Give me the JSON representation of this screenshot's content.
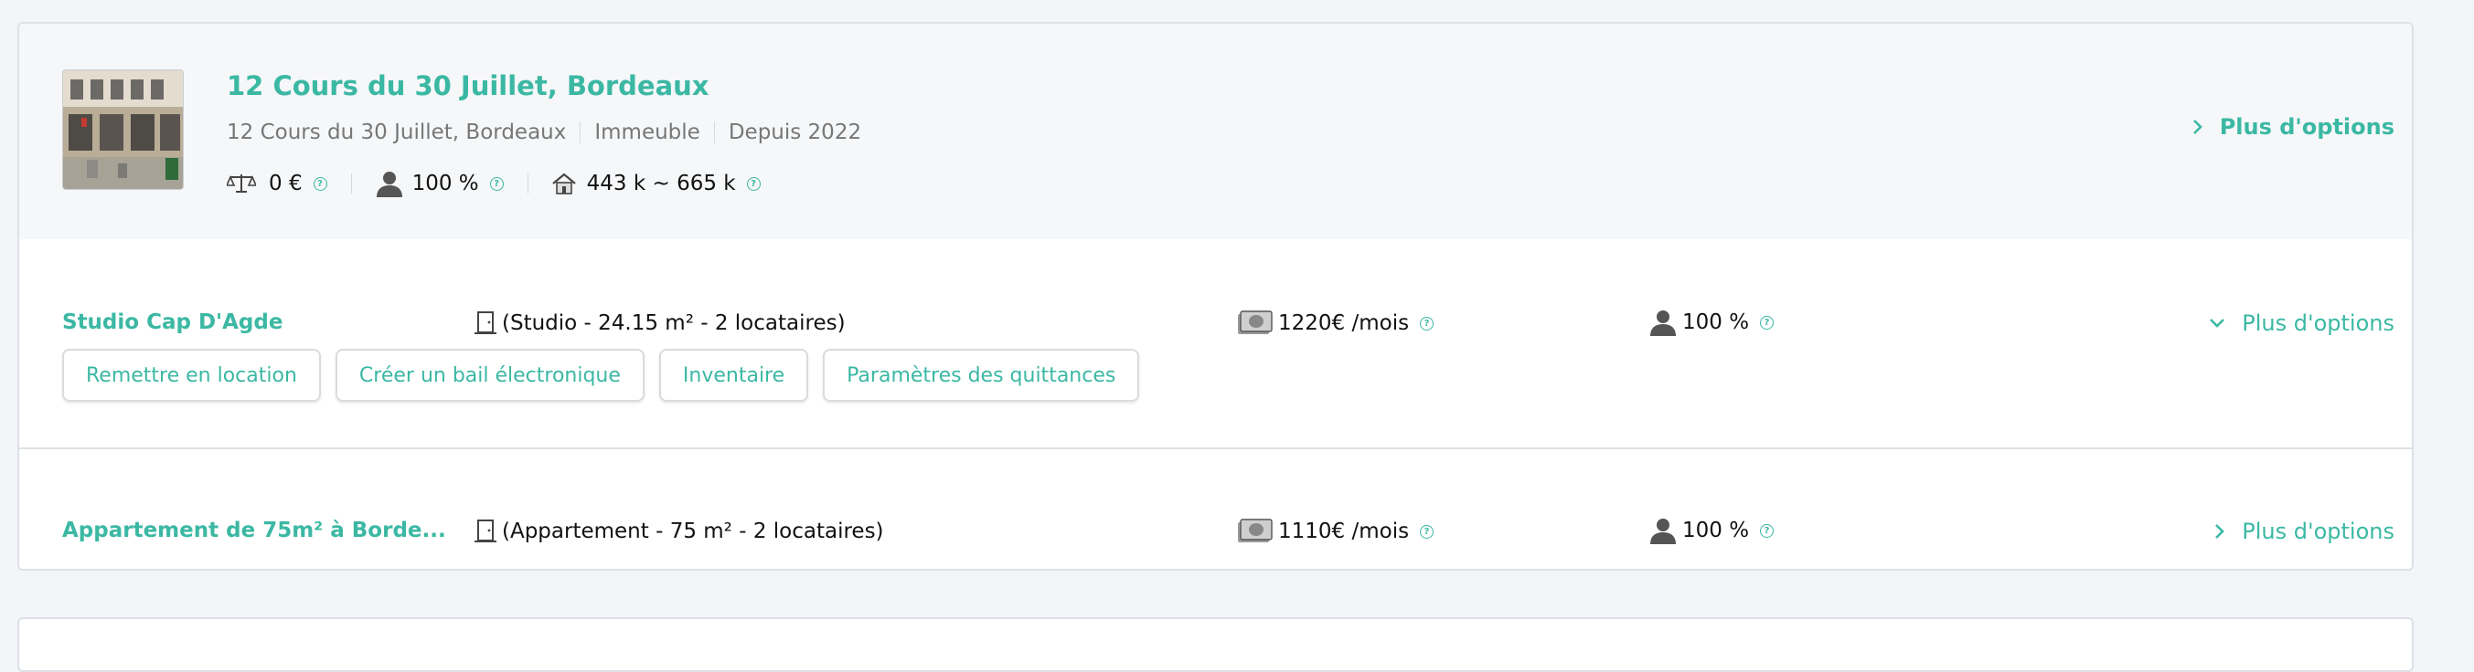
{
  "building": {
    "title": "12 Cours du 30 Juillet, Bordeaux",
    "address": "12 Cours du 30 Juillet, Bordeaux",
    "type": "Immeuble",
    "since": "Depuis 2022",
    "stats": {
      "balance": "0 €",
      "occupancy": "100 %",
      "valuation": "443 k ~ 665 k"
    },
    "options_label": "Plus d'options"
  },
  "units": [
    {
      "name": "Studio Cap D'Agde",
      "description": "(Studio - 24.15 m² - 2 locataires)",
      "rent": "1220€ /mois",
      "occupancy": "100 %",
      "options_label": "Plus d'options",
      "expanded": true,
      "actions": [
        "Remettre en location",
        "Créer un bail électronique",
        "Inventaire",
        "Paramètres des quittances"
      ]
    },
    {
      "name": "Appartement de 75m² à Borde...",
      "description": "(Appartement - 75 m² - 2 locataires)",
      "rent": "1110€ /mois",
      "occupancy": "100 %",
      "options_label": "Plus d'options",
      "expanded": false
    }
  ],
  "icons": {
    "help": "?",
    "balance": "scale-icon",
    "occupant": "person-icon",
    "valuation": "house-icon",
    "door": "door-icon",
    "money": "banknote-icon",
    "chevron_right": "chevron-right-icon",
    "chevron_down": "chevron-down-icon"
  },
  "colors": {
    "accent": "#3bb8a3",
    "header_bg": "#f5f7f9",
    "page_bg": "#f3f5f9"
  }
}
